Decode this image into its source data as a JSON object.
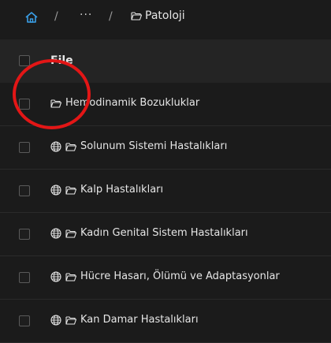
{
  "breadcrumb": {
    "home_icon": "home-icon",
    "separator": "/",
    "ellipsis": "···",
    "current_label": "Patoloji",
    "folder_icon": "folder-open-icon",
    "accent_color": "#3aa0e8"
  },
  "table": {
    "header": {
      "label": "File"
    },
    "rows": [
      {
        "label": "Hemodinamik Bozukluklar",
        "globe": false
      },
      {
        "label": "Solunum Sistemi Hastalıkları",
        "globe": true
      },
      {
        "label": "Kalp Hastalıkları",
        "globe": true
      },
      {
        "label": "Kadın Genital Sistem Hastalıkları",
        "globe": true
      },
      {
        "label": "Hücre Hasarı, Ölümü ve Adaptasyonlar",
        "globe": true
      },
      {
        "label": "Kan Damar Hastalıkları",
        "globe": true
      }
    ]
  },
  "annotation": {
    "color": "#e31616"
  }
}
